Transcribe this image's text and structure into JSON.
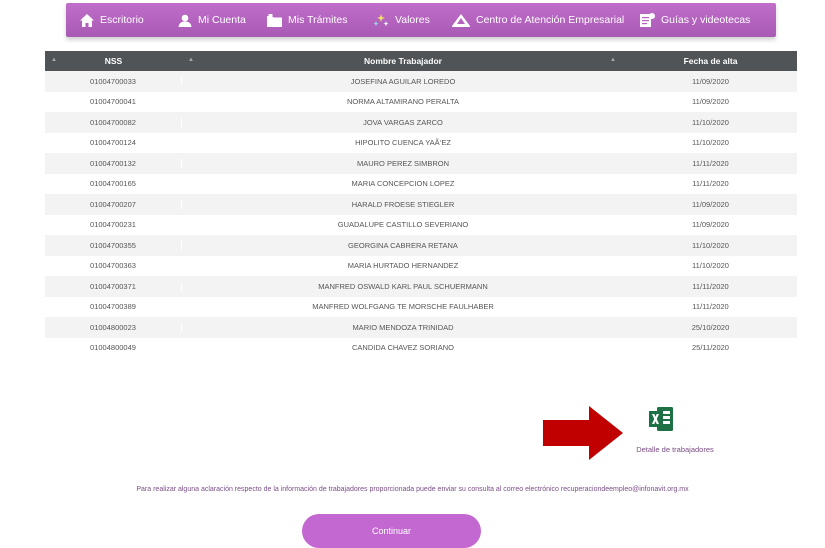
{
  "nav": {
    "items": [
      {
        "label": "Escritorio",
        "icon": "home-icon"
      },
      {
        "label": "Mi Cuenta",
        "icon": "user-icon"
      },
      {
        "label": "Mis Trámites",
        "icon": "folder-icon"
      },
      {
        "label": "Valores",
        "icon": "sparkles-icon"
      },
      {
        "label": "Centro de Atención Empresarial",
        "icon": "building-icon"
      },
      {
        "label": "Guías y videotecas",
        "icon": "document-icon"
      }
    ]
  },
  "table": {
    "headers": [
      "NSS",
      "Nombre Trabajador",
      "Fecha de alta"
    ],
    "rows": [
      [
        "01004700033",
        "JOSEFINA AGUILAR LOREDO",
        "11/09/2020"
      ],
      [
        "01004700041",
        "NORMA ALTAMIRANO PERALTA",
        "11/09/2020"
      ],
      [
        "01004700082",
        "JOVA VARGAS ZARCO",
        "11/10/2020"
      ],
      [
        "01004700124",
        "HIPOLITO CUENCA YAÃ‘EZ",
        "11/10/2020"
      ],
      [
        "01004700132",
        "MAURO PEREZ SIMBRON",
        "11/11/2020"
      ],
      [
        "01004700165",
        "MARIA CONCEPCION LOPEZ",
        "11/11/2020"
      ],
      [
        "01004700207",
        "HARALD FROESE STIEGLER",
        "11/09/2020"
      ],
      [
        "01004700231",
        "GUADALUPE CASTILLO SEVERIANO",
        "11/09/2020"
      ],
      [
        "01004700355",
        "GEORGINA CABRERA RETANA",
        "11/10/2020"
      ],
      [
        "01004700363",
        "MARIA HURTADO HERNANDEZ",
        "11/10/2020"
      ],
      [
        "01004700371",
        "MANFRED OSWALD KARL PAUL SCHUERMANN",
        "11/11/2020"
      ],
      [
        "01004700389",
        "MANFRED WOLFGANG TE MORSCHE FAULHABER",
        "11/11/2020"
      ],
      [
        "01004800023",
        "MARIO MENDOZA TRINIDAD",
        "25/10/2020"
      ],
      [
        "01004800049",
        "CANDIDA CHAVEZ SORIANO",
        "25/11/2020"
      ]
    ]
  },
  "download": {
    "label": "Detalle de trabajadores",
    "icon": "excel-icon"
  },
  "note": {
    "text": "Para realizar alguna aclaración respecto de la información de trabajadores proporcionada puede enviar su consulta al correo electrónico ",
    "email": "recuperaciondeempleo@infonavit.org.mx"
  },
  "continue_label": "Continuar",
  "colors": {
    "accent": "#b764c2",
    "header_bg": "#505457",
    "arrow": "#c00000",
    "excel": "#1e7145"
  }
}
